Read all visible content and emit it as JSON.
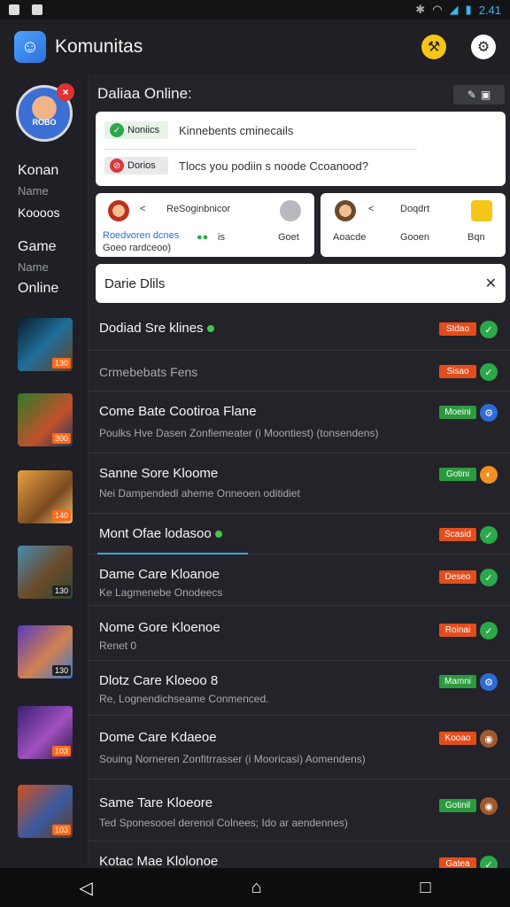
{
  "statusbar": {
    "time": "2.41"
  },
  "appbar": {
    "title": "Komunitas"
  },
  "sidebar": {
    "avatar_text": "ROBO",
    "labels": [
      "Konan",
      "Name",
      "Koooos",
      "Game",
      "Name",
      "Online"
    ],
    "thumb_badges": [
      "130",
      "300",
      "140",
      "130",
      "130",
      "103",
      "103"
    ]
  },
  "section": {
    "heading": "Daliaa Online:"
  },
  "notifications": [
    {
      "pill": "Noniics",
      "text": "Kinnebents cminecails",
      "status": "ok"
    },
    {
      "pill": "Dorios",
      "text": "Tlocs you podiin s noode Ccoanood?",
      "status": "no"
    }
  ],
  "mini_cards": {
    "a": {
      "top": "ReSoginbnicor",
      "chev": "<",
      "link": "Roedvoren dcnes",
      "sub": "Goeo rardceoo)",
      "count": "is",
      "right": "Goet"
    },
    "b": {
      "chev": "<",
      "top": "Doqdrt",
      "col1": "Aoacde",
      "col2": "Gooen",
      "col3": "Bqn"
    }
  },
  "search": {
    "value": "Darie Dlils"
  },
  "rows": [
    {
      "title": "Dodiad Sre klines",
      "online": true,
      "sub": "",
      "chip": "Stdao",
      "chip_color": "orange",
      "action": "✓",
      "action_color": "green"
    },
    {
      "title": "",
      "sub": "Crmebebats Fens",
      "chip": "Sisao",
      "chip_color": "orange",
      "action": "✓",
      "action_color": "green"
    },
    {
      "title": "Come Bate Cootiroa Flane",
      "sub": "Poulks Hve Dasen Zonfiemeater (i Moontiest) (tonsendens)",
      "chip": "Moeini",
      "chip_color": "green",
      "action": "⚙",
      "action_color": "blue"
    },
    {
      "title": "Sanne Sore Kloome",
      "sub": "Nei Dampendedl aheme Onneoen oditidiet",
      "chip": "Gotini",
      "chip_color": "green",
      "action": "◐",
      "action_color": "orange"
    },
    {
      "title": "Mont Ofae lodasoo",
      "online": true,
      "sub": "",
      "chip": "Scasid",
      "chip_color": "orange",
      "action": "✓",
      "action_color": "green"
    },
    {
      "title": "Dame Care Kloanoe",
      "sub": "Ke Lagmenebe Onodeecs",
      "chip": "Deseo",
      "chip_color": "orange",
      "action": "✓",
      "action_color": "green"
    },
    {
      "title": "Nome Gore Kloenoe",
      "sub": "Renet 0",
      "chip": "Roinai",
      "chip_color": "orange",
      "action": "✓",
      "action_color": "green"
    },
    {
      "title": "Dlotz Care Kloeoo 8",
      "sub": "Re, Lognendichseame Conmenced.",
      "chip": "Mamni",
      "chip_color": "green",
      "action": "⚙",
      "action_color": "blue"
    },
    {
      "title": "Dome Care Kdaeoe",
      "sub": "Souing Norneren Zonfitrrasser (i Mooricasi) Aomendens)",
      "chip": "Kooao",
      "chip_color": "orange",
      "action": "◉",
      "action_color": "brown"
    },
    {
      "title": "Same Tare Kloeore",
      "sub": "Ted Sponesooel derenol Colnees; Ido ar aendennes)",
      "chip": "Gotinil",
      "chip_color": "green",
      "action": "◉",
      "action_color": "brown"
    },
    {
      "title": "Kotac Mae Klolonoe",
      "sub": "",
      "chip": "Gatea",
      "chip_color": "orange",
      "action": "✓",
      "action_color": "green"
    }
  ],
  "navbar": {
    "back": "◁",
    "home": "⌂",
    "recent": "□"
  }
}
